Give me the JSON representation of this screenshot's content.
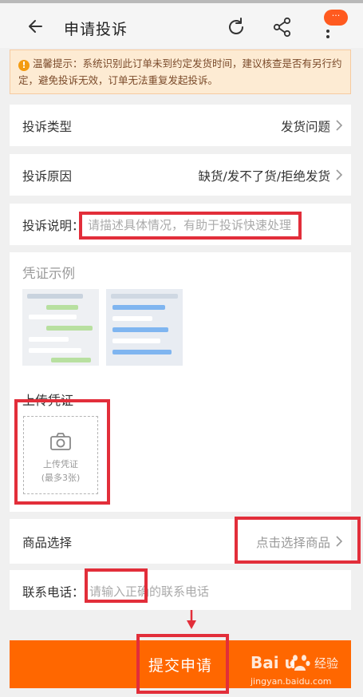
{
  "header": {
    "title": "申请投诉",
    "badge": "···"
  },
  "notice": {
    "prefix": "温馨提示：",
    "text": "系统识别此订单未到约定发货时间，建议核查是否有另行约定，避免投诉无效，订单无法重复发起投诉。"
  },
  "form": {
    "type_label": "投诉类型",
    "type_value": "发货问题",
    "reason_label": "投诉原因",
    "reason_value": "缺货/发不了货/拒绝发货",
    "desc_label": "投诉说明：",
    "desc_placeholder": "请描述具体情况，有助于投诉快速处理",
    "example_title": "凭证示例",
    "upload_title": "上传凭证",
    "upload_line1": "上传凭证",
    "upload_line2": "(最多3张)",
    "product_label": "商品选择",
    "product_value": "点击选择商品",
    "phone_label": "联系电话：",
    "phone_placeholder": "请输入正确的联系电话"
  },
  "submit_label": "提交申请",
  "watermark": {
    "brand": "Bai  u",
    "jingyan": "经验",
    "site": "jingyan.baidu.com"
  },
  "colors": {
    "accent": "#ff6700",
    "highlight": "#e22e3a",
    "notice_bg": "#fdebd3"
  },
  "icons": [
    "back-arrow-icon",
    "refresh-icon",
    "share-icon",
    "more-icon",
    "warning-icon",
    "chevron-right-icon",
    "camera-icon",
    "down-arrow-icon",
    "baidu-paw-icon"
  ]
}
